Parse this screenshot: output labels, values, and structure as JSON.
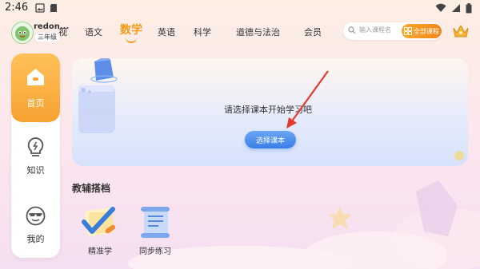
{
  "status_bar": {
    "time": "2:46"
  },
  "header": {
    "user": {
      "name": "redon...",
      "grade": "三年级"
    },
    "subjects": [
      {
        "label": "视",
        "active": false
      },
      {
        "label": "语文",
        "active": false
      },
      {
        "label": "数学",
        "active": true
      },
      {
        "label": "英语",
        "active": false
      },
      {
        "label": "科学",
        "active": false
      },
      {
        "label": "道德与法治",
        "active": false
      },
      {
        "label": "会员",
        "active": false
      }
    ],
    "search": {
      "placeholder": "输入课程名"
    },
    "all_courses_label": "全部课程"
  },
  "sidebar": {
    "items": [
      {
        "label": "首页",
        "icon": "home-icon",
        "active": true
      },
      {
        "label": "知识",
        "icon": "lightbulb-icon",
        "active": false
      },
      {
        "label": "我的",
        "icon": "smiley-sunglasses-icon",
        "active": false
      }
    ]
  },
  "main_card": {
    "prompt": "请选择课本开始学习吧",
    "button_label": "选择课本"
  },
  "tools": {
    "title": "教辅搭档",
    "items": [
      {
        "label": "精准学",
        "icon": "check-mark-icon"
      },
      {
        "label": "同步练习",
        "icon": "scroll-icon"
      }
    ]
  },
  "colors": {
    "accent": "#f29a19",
    "primary_button": "#3b7ee8",
    "sidebar_active": "#f7a232"
  }
}
